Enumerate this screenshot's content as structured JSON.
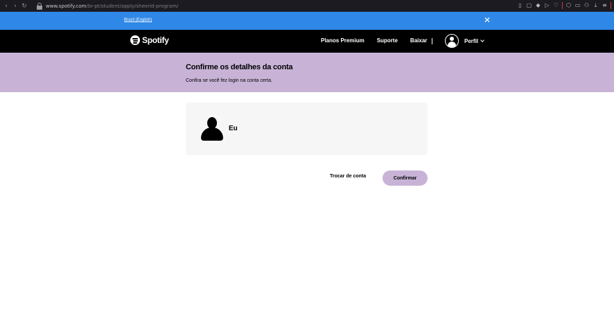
{
  "browser": {
    "url_host": "www.spotify.com",
    "url_path": "/br-pt/student/apply/sheerid-program/"
  },
  "locale_banner": {
    "link_text": "Brazil (English)",
    "close_glyph": "✕"
  },
  "header": {
    "logo_text": "Spotify",
    "nav": [
      {
        "label": "Planos Premium"
      },
      {
        "label": "Suporte"
      },
      {
        "label": "Baixar"
      }
    ],
    "profile_label": "Perfil"
  },
  "hero": {
    "title": "Confirme os detalhes da conta",
    "subtitle": "Confira se você fez login na conta certa."
  },
  "account": {
    "name": "Eu"
  },
  "actions": {
    "switch_label": "Trocar de conta",
    "confirm_label": "Confirmar"
  },
  "colors": {
    "banner_blue": "#2f87e7",
    "hero_purple": "#c8b3d7",
    "header_black": "#000000",
    "card_gray": "#f6f6f6"
  }
}
